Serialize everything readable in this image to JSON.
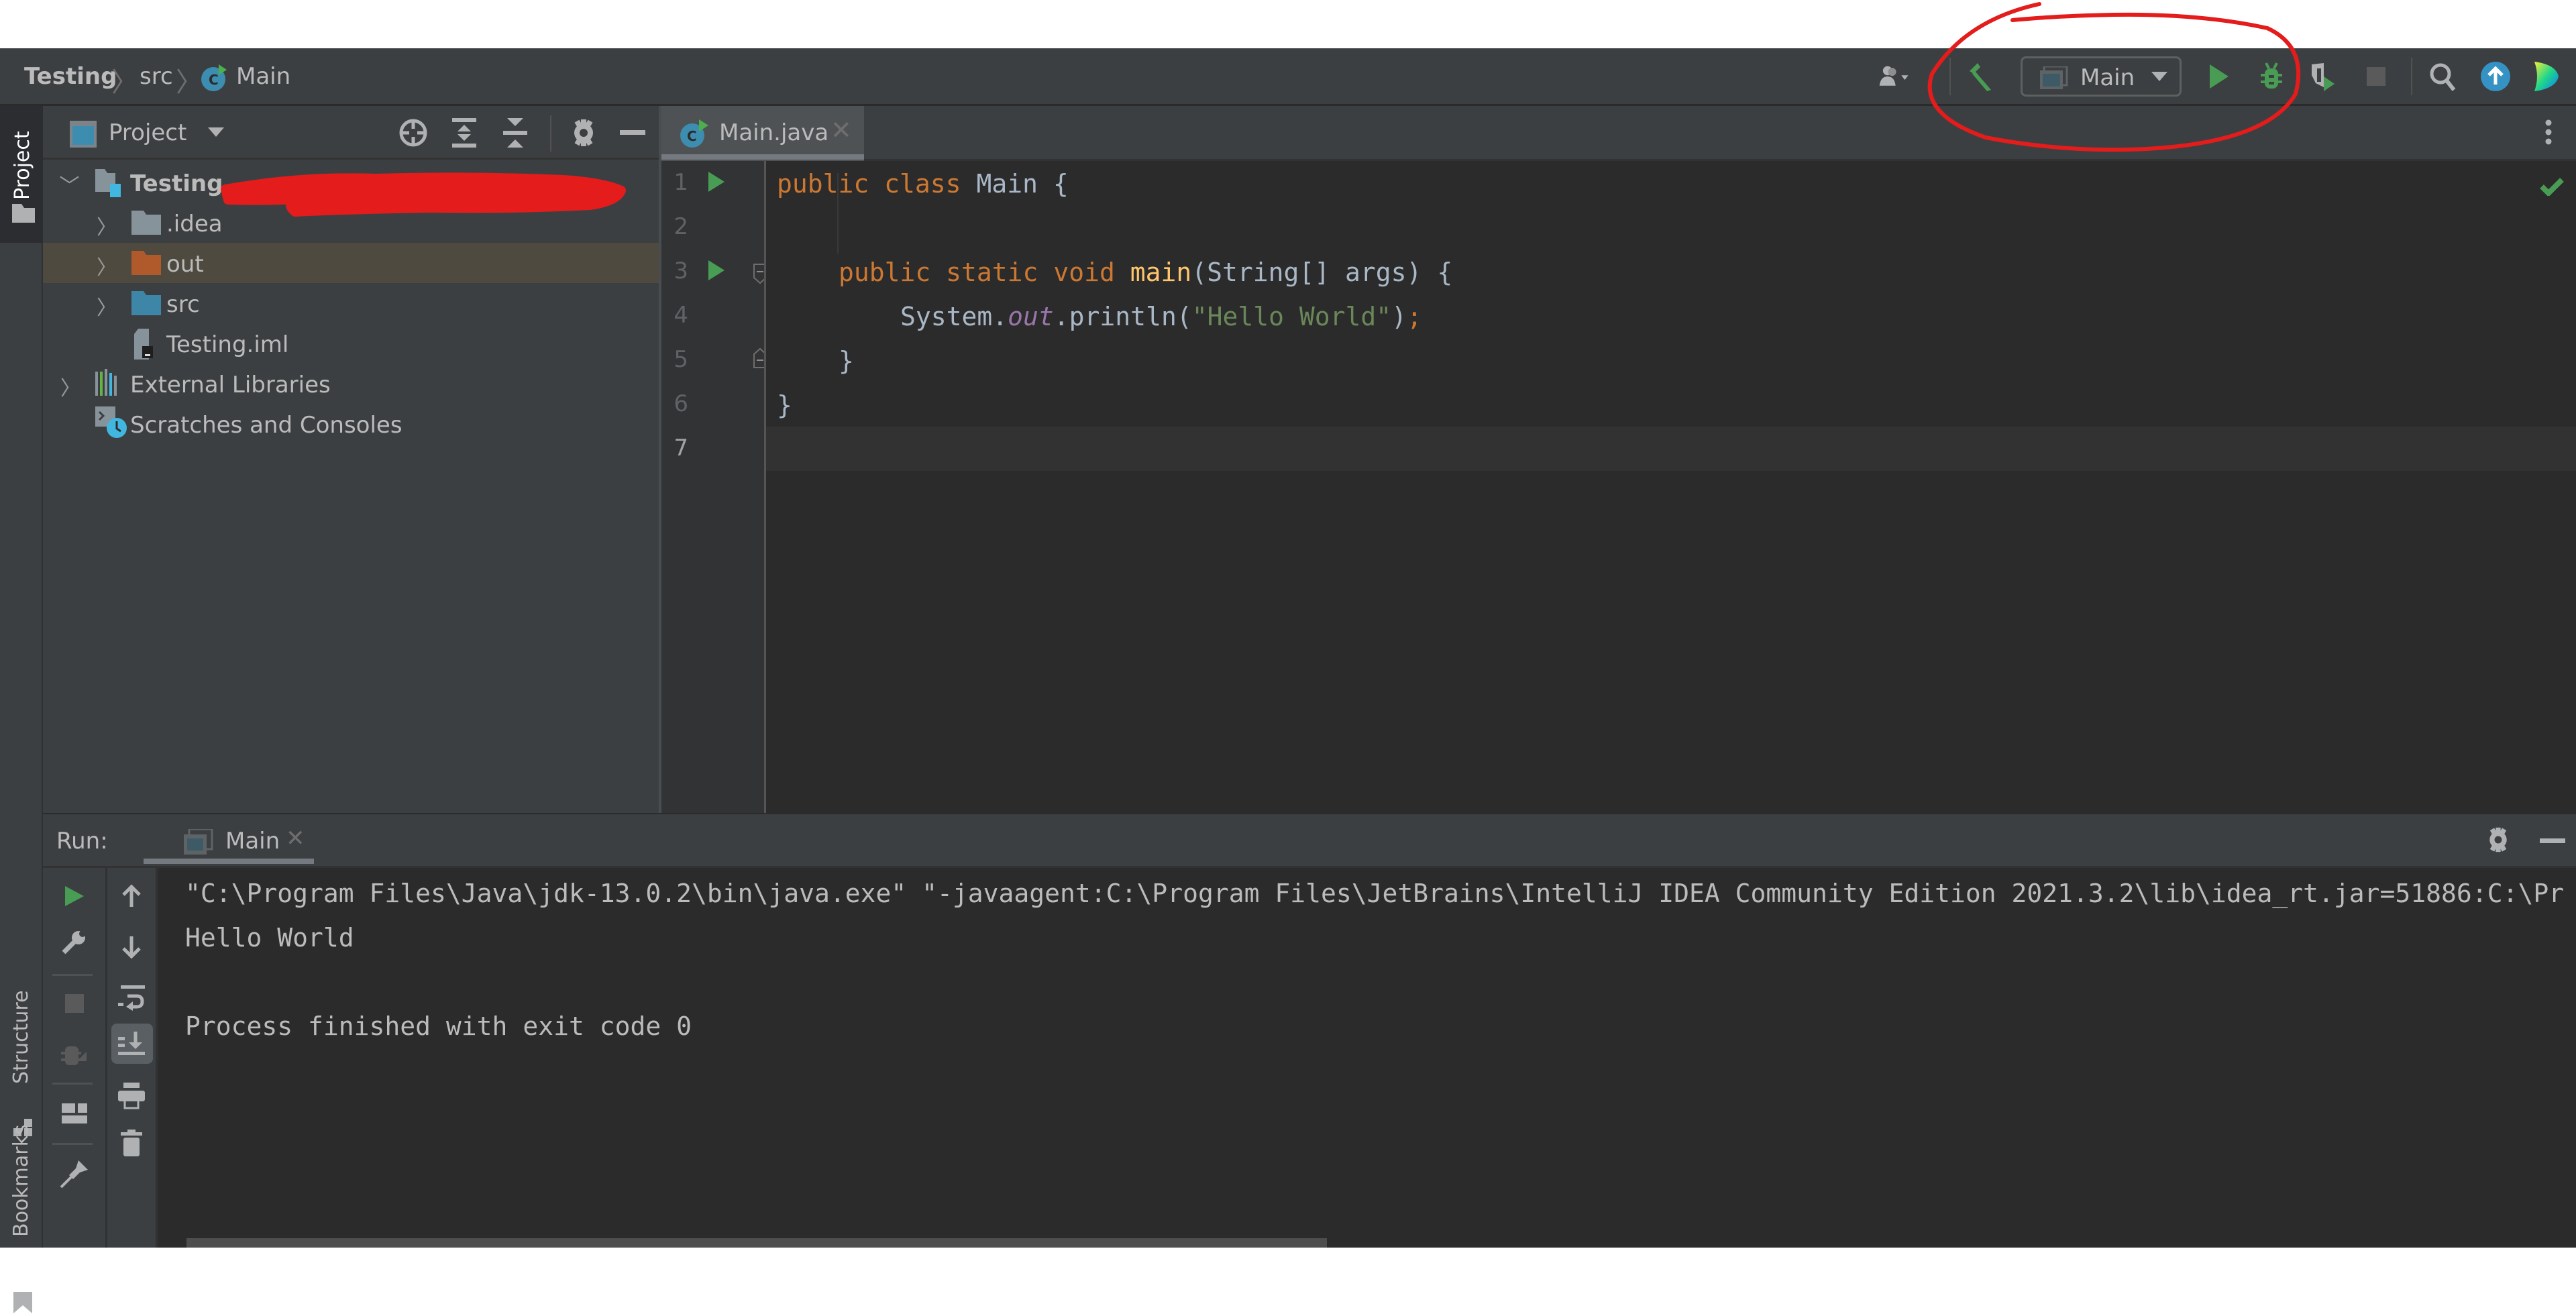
{
  "navbar": {
    "breadcrumbs": [
      "Testing",
      "src",
      "Main"
    ],
    "run_config": "Main",
    "icons": [
      "user-dropdown-icon",
      "build-hammer-icon",
      "run-icon",
      "debug-icon",
      "run-with-coverage-icon",
      "stop-icon",
      "search-icon",
      "update-icon",
      "jetbrains-toolbox-icon"
    ]
  },
  "left_strip": {
    "tabs": [
      "Project",
      "Structure",
      "Bookmarks"
    ]
  },
  "project_panel": {
    "title": "Project",
    "toolbar_icons": [
      "locate-icon",
      "expand-all-icon",
      "collapse-all-icon",
      "gear-icon",
      "minimize-icon"
    ],
    "tree": [
      {
        "label": "Testing",
        "type": "module",
        "expanded": true,
        "redacted_suffix": true
      },
      {
        "label": ".idea",
        "type": "folder"
      },
      {
        "label": "out",
        "type": "folder-excluded",
        "selected": true
      },
      {
        "label": "src",
        "type": "folder-source"
      },
      {
        "label": "Testing.iml",
        "type": "file"
      },
      {
        "label": "External Libraries",
        "type": "libraries"
      },
      {
        "label": "Scratches and Consoles",
        "type": "scratches"
      }
    ]
  },
  "editor": {
    "tab": "Main.java",
    "line_numbers": [
      "1",
      "2",
      "3",
      "4",
      "5",
      "6",
      "7"
    ],
    "status": "no-problems",
    "code": {
      "l1": [
        "public",
        "class",
        "Main {"
      ],
      "l3": [
        "public",
        "static",
        "void",
        "main",
        "(String[] args) {"
      ],
      "l4": [
        "System.",
        "out",
        ".println(",
        "\"Hello World\"",
        ")",
        ";"
      ],
      "l5": "}",
      "l6": "}"
    }
  },
  "run_panel": {
    "label": "Run:",
    "tab": "Main",
    "console": [
      "\"C:\\Program Files\\Java\\jdk-13.0.2\\bin\\java.exe\" \"-javaagent:C:\\Program Files\\JetBrains\\IntelliJ IDEA Community Edition 2021.3.2\\lib\\idea_rt.jar=51886:C:\\Pr",
      "Hello World",
      "",
      "Process finished with exit code 0"
    ]
  },
  "colors": {
    "accent_green": "#499c54",
    "keyword": "#cc7832",
    "function": "#ffc66d",
    "string": "#6a8759",
    "field": "#9876aa",
    "annotation_red": "#e41c1c"
  }
}
